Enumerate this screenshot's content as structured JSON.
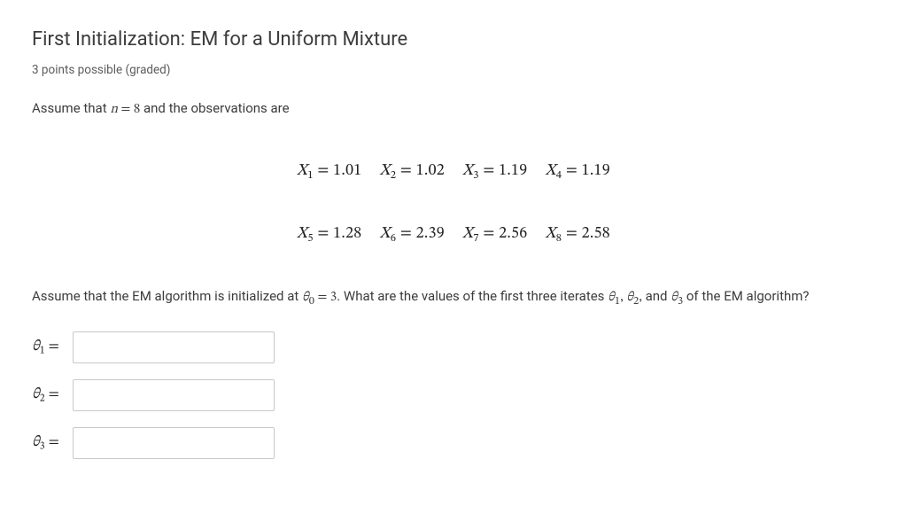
{
  "title": "First Initialization: EM for a Uniform Mixture",
  "subtitle": "3 points possible (graded)",
  "intro_prefix": "Assume that ",
  "intro_math_html": "<span class='math-italic'>n</span> = 8",
  "intro_suffix": " and the observations are",
  "obs": {
    "row1": [
      {
        "sub": "1",
        "val": "1.01"
      },
      {
        "sub": "2",
        "val": "1.02"
      },
      {
        "sub": "3",
        "val": "1.19"
      },
      {
        "sub": "4",
        "val": "1.19"
      }
    ],
    "row2": [
      {
        "sub": "5",
        "val": "1.28"
      },
      {
        "sub": "6",
        "val": "2.39"
      },
      {
        "sub": "7",
        "val": "2.56"
      },
      {
        "sub": "8",
        "val": "2.58"
      }
    ]
  },
  "question_prefix": "Assume that the EM algorithm is initialized at ",
  "question_theta0_html": "<span class='math-italic'>θ</span><sub>0</sub> = 3",
  "question_mid": ". What are the values of the first three iterates ",
  "question_thetas_html": "<span class='math-italic'>θ</span><sub>1</sub>, <span class='math-italic'>θ</span><sub>2</sub>,",
  "question_and": " and ",
  "question_theta3_html": "<span class='math-italic'>θ</span><sub>3</sub>",
  "question_suffix": " of the EM algorithm?",
  "answers": [
    {
      "label_html": "<span class='math-italic'>θ</span><sub>1</sub> =",
      "name": "theta1-input"
    },
    {
      "label_html": "<span class='math-italic'>θ</span><sub>2</sub> =",
      "name": "theta2-input"
    },
    {
      "label_html": "<span class='math-italic'>θ</span><sub>3</sub> =",
      "name": "theta3-input"
    }
  ]
}
